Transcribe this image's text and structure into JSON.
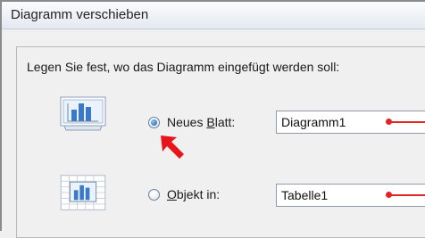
{
  "dialog": {
    "title": "Diagramm verschieben",
    "prompt": "Legen Sie fest, wo das Diagramm eingefügt werden soll:"
  },
  "options": [
    {
      "label_prefix": "Neues ",
      "label_accel": "B",
      "label_suffix": "latt:",
      "value": "Diagramm1",
      "selected": true,
      "icon": "chart-sheet-icon"
    },
    {
      "label_prefix": "",
      "label_accel": "O",
      "label_suffix": "bjekt in:",
      "value": "Tabelle1",
      "selected": false,
      "icon": "embedded-chart-icon"
    }
  ],
  "annotations": {
    "pointer_arrow_color": "#e8141c",
    "marker_color": "#e02424"
  }
}
